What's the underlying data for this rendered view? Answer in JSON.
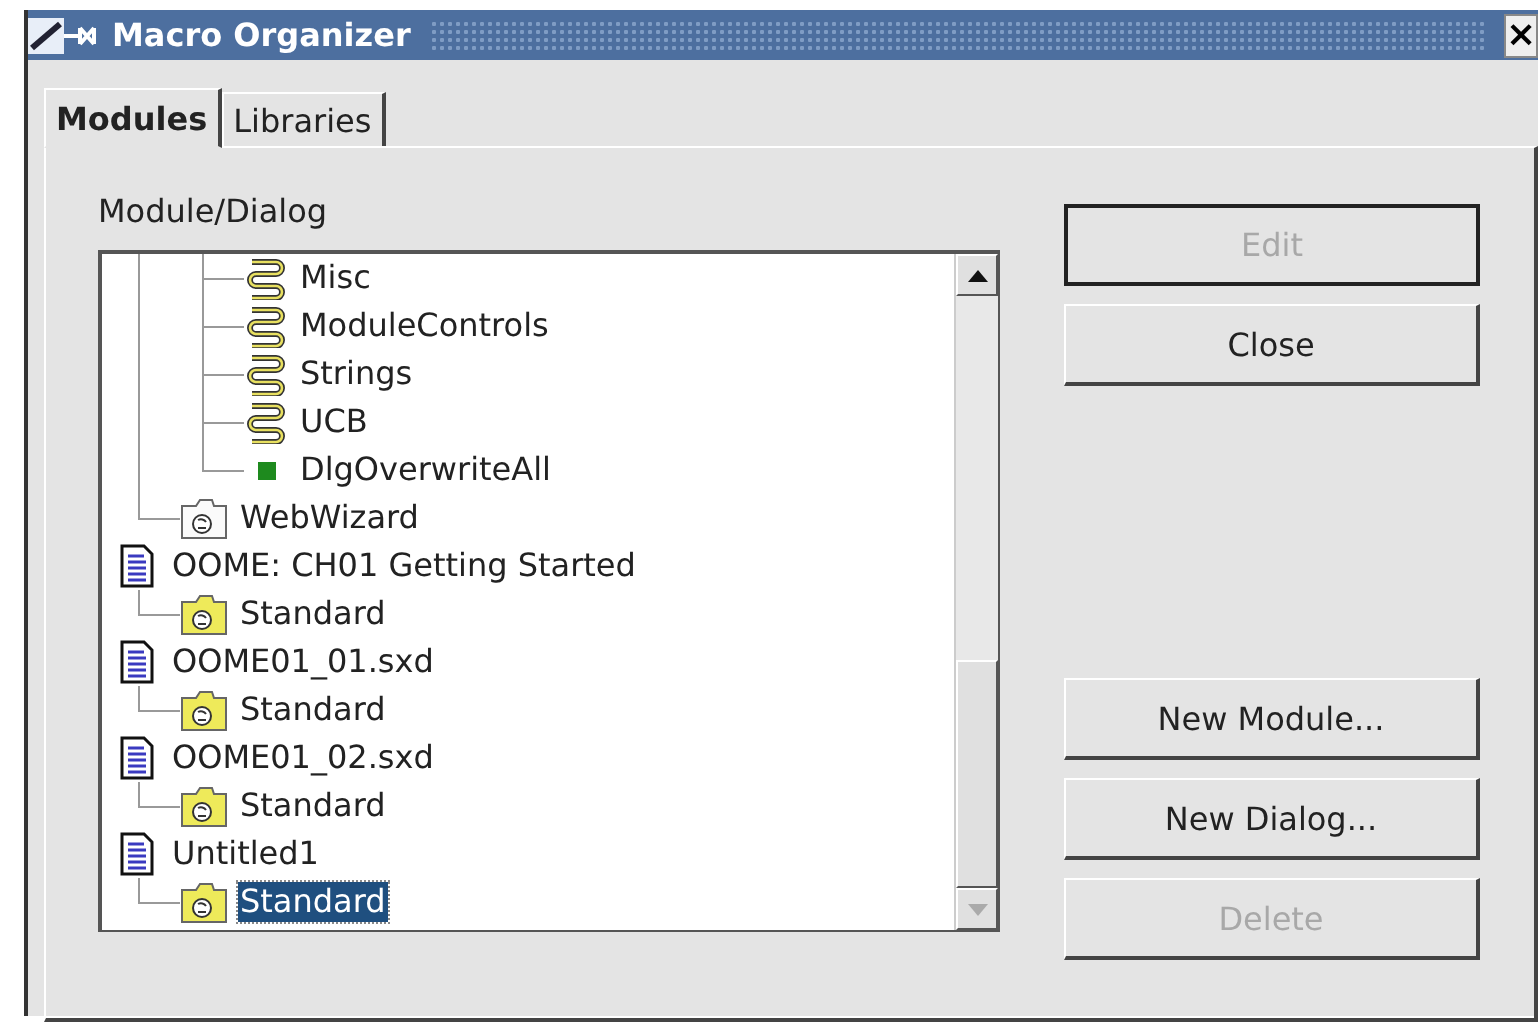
{
  "window": {
    "title": "Macro Organizer",
    "close_label": "×"
  },
  "tabs": [
    {
      "label": "Modules",
      "selected": true
    },
    {
      "label": "Libraries",
      "selected": false
    }
  ],
  "tree_label": "Module/Dialog",
  "tree": [
    {
      "kind": "hidden",
      "children": [
        {
          "kind": "hidden",
          "children": [
            {
              "kind": "module",
              "label": "Misc",
              "selected": false
            },
            {
              "kind": "module",
              "label": "ModuleControls",
              "selected": false
            },
            {
              "kind": "module",
              "label": "Strings",
              "selected": false
            },
            {
              "kind": "module",
              "label": "UCB",
              "selected": false
            },
            {
              "kind": "dialog",
              "label": "DlgOverwriteAll",
              "selected": false
            }
          ]
        },
        {
          "kind": "library_unloaded",
          "label": "WebWizard",
          "selected": false
        }
      ]
    },
    {
      "kind": "document",
      "label": "OOME: CH01 Getting Started",
      "selected": false,
      "children": [
        {
          "kind": "library",
          "label": "Standard",
          "selected": false
        }
      ]
    },
    {
      "kind": "document",
      "label": "OOME01_01.sxd",
      "selected": false,
      "children": [
        {
          "kind": "library",
          "label": "Standard",
          "selected": false
        }
      ]
    },
    {
      "kind": "document",
      "label": "OOME01_02.sxd",
      "selected": false,
      "children": [
        {
          "kind": "library",
          "label": "Standard",
          "selected": false
        }
      ]
    },
    {
      "kind": "document",
      "label": "Untitled1",
      "selected": false,
      "children": [
        {
          "kind": "library",
          "label": "Standard",
          "selected": true
        }
      ]
    }
  ],
  "buttons": [
    {
      "label": "Edit",
      "disabled": true,
      "default": true
    },
    {
      "label": "Close",
      "disabled": false,
      "default": false
    },
    {
      "label": "New Module...",
      "disabled": false,
      "default": false
    },
    {
      "label": "New Dialog...",
      "disabled": false,
      "default": false
    },
    {
      "label": "Delete",
      "disabled": true,
      "default": false
    }
  ]
}
